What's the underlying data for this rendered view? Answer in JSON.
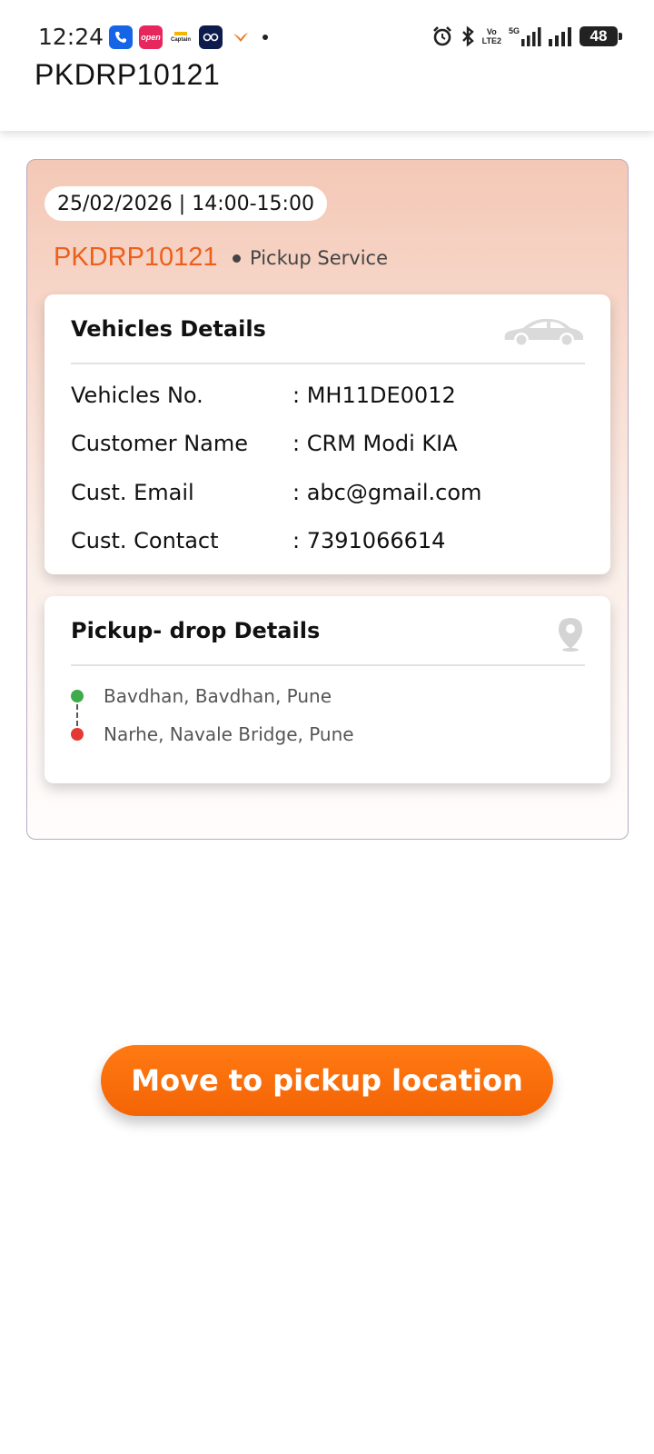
{
  "status_bar": {
    "time": "12:24",
    "notification_icons": [
      "phone-app-icon",
      "open-app-icon",
      "captain-app-icon",
      "goggles-app-icon",
      "bird-app-icon"
    ],
    "open_label": "open",
    "captain_label": "Captain",
    "network_label_top": "Vo",
    "network_label_bottom": "LTE2",
    "network_5g": "5G",
    "battery": "48"
  },
  "header": {
    "title": "PKDRP10121"
  },
  "booking": {
    "slot": "25/02/2026 | 14:00-15:00",
    "id": "PKDRP10121",
    "service_type": "Pickup Service"
  },
  "vehicle_details": {
    "title": "Vehicles Details",
    "icon": "car-icon",
    "rows": [
      {
        "label": "Vehicles No.",
        "value": ": MH11DE0012"
      },
      {
        "label": "Customer Name",
        "value": ": CRM Modi KIA"
      },
      {
        "label": "Cust. Email",
        "value": ": abc@gmail.com"
      },
      {
        "label": "Cust. Contact",
        "value": ": 7391066614"
      }
    ]
  },
  "pickup_details": {
    "title": "Pickup- drop Details",
    "icon": "location-pin-icon",
    "pickup": "Bavdhan, Bavdhan, Pune",
    "drop": "Narhe, Navale Bridge, Pune"
  },
  "actions": {
    "primary_label": "Move to pickup location"
  },
  "colors": {
    "accent": "#f46406",
    "booking_id": "#ec5f1c",
    "pickup_dot": "#3fab4a",
    "drop_dot": "#e53935"
  }
}
